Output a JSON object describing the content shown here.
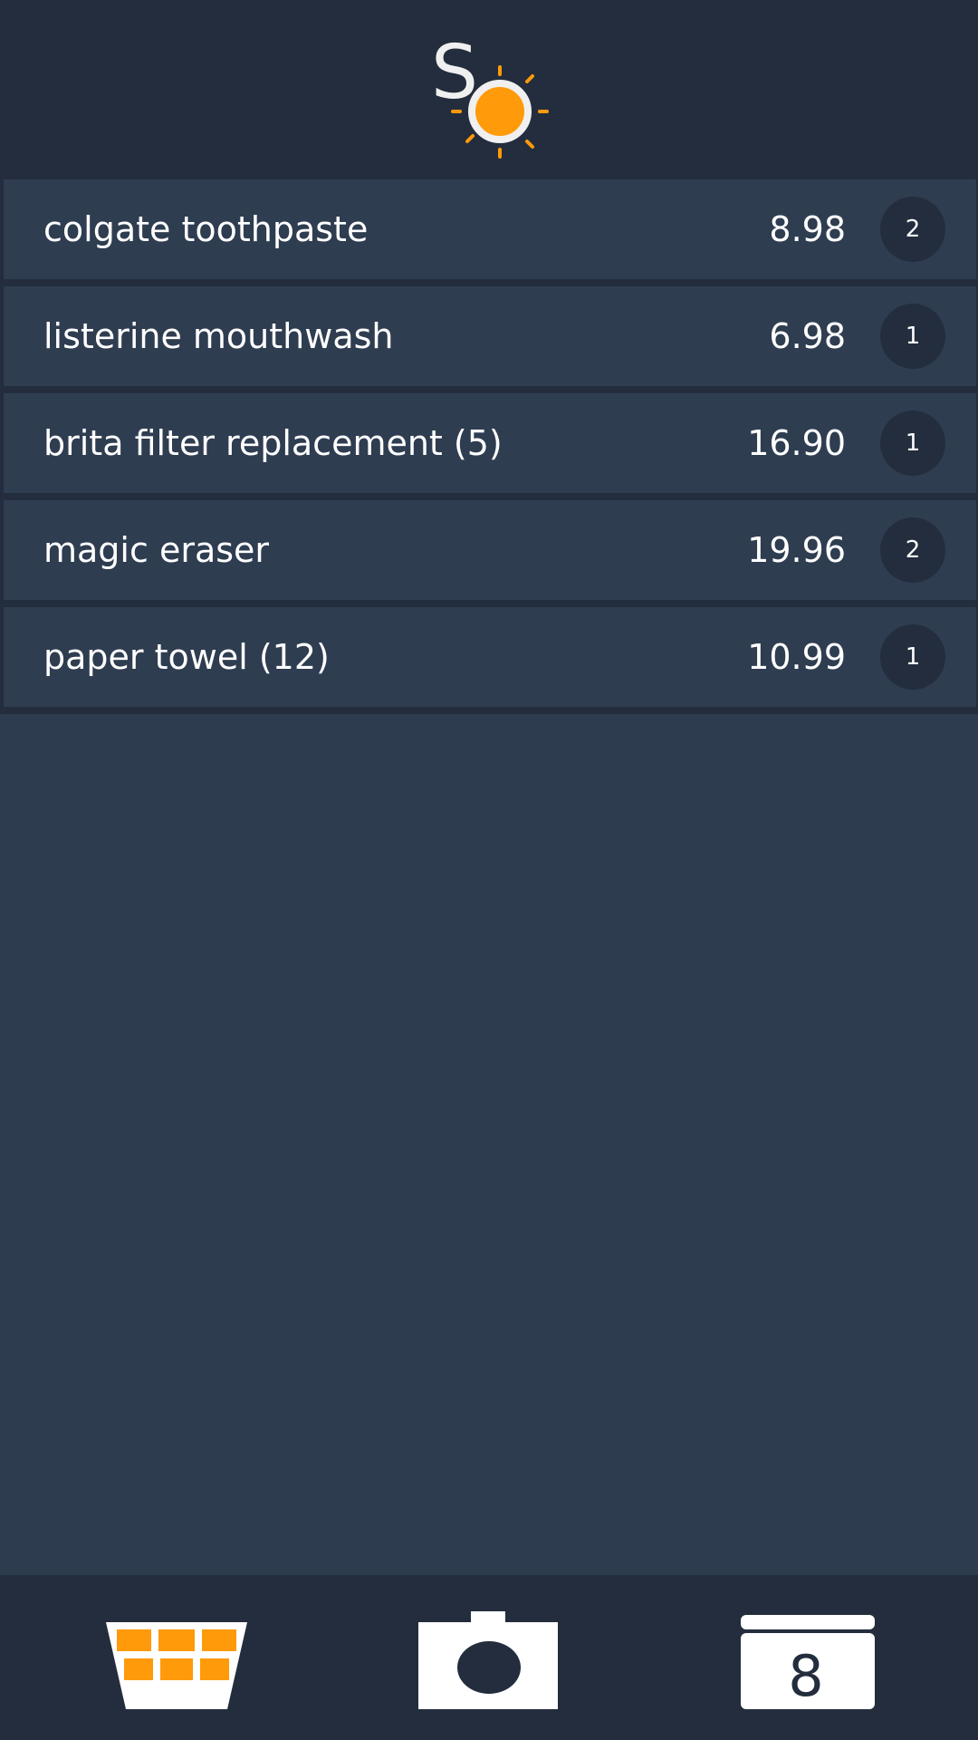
{
  "app": {
    "logo_text": "So"
  },
  "colors": {
    "header_bg": "#232d3d",
    "row_bg": "#2f3d51",
    "accent": "#ff9a0b",
    "text": "#ffffff"
  },
  "items": [
    {
      "name": "colgate toothpaste",
      "price": "8.98",
      "qty": "2"
    },
    {
      "name": "listerine mouthwash",
      "price": "6.98",
      "qty": "1"
    },
    {
      "name": "brita filter replacement (5)",
      "price": "16.90",
      "qty": "1"
    },
    {
      "name": "magic eraser",
      "price": "19.96",
      "qty": "2"
    },
    {
      "name": "paper towel (12)",
      "price": "10.99",
      "qty": "1"
    }
  ],
  "nav": {
    "basket_icon": "basket-icon",
    "camera_icon": "camera-icon",
    "calendar_icon": "calendar-icon",
    "calendar_day": "8"
  }
}
